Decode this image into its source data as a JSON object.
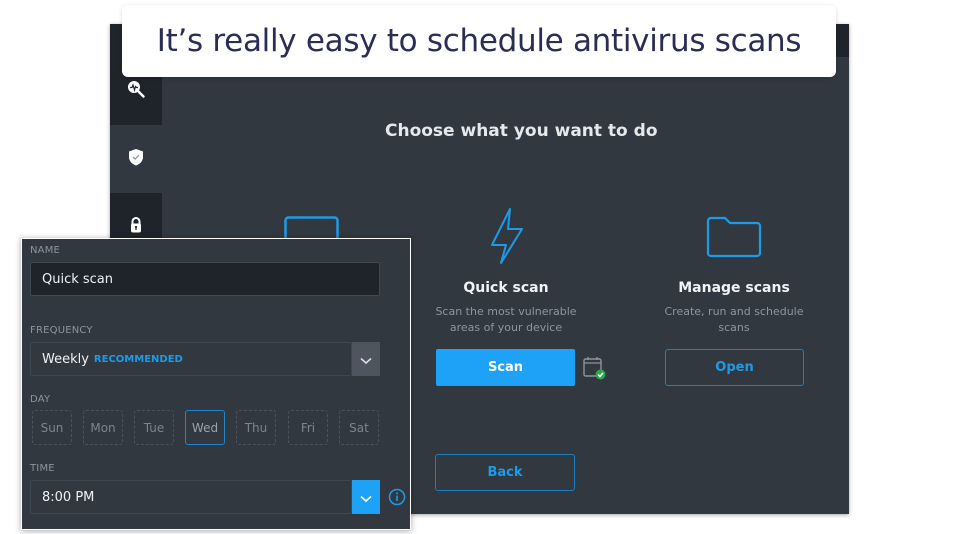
{
  "caption": "It’s really easy to schedule antivirus scans",
  "sidebar": {
    "items": [
      {
        "icon": "scan-search-icon",
        "active": false
      },
      {
        "icon": "shield-check-icon",
        "active": true
      },
      {
        "icon": "lock-icon",
        "active": false
      }
    ]
  },
  "main": {
    "title": "Choose what you want to do",
    "cards": [
      {
        "icon": "monitor-icon",
        "title": "",
        "description": ""
      },
      {
        "icon": "lightning-bolt-icon",
        "title": "Quick scan",
        "description": "Scan the most vulnerable areas of your device",
        "button": "Scan",
        "schedule_icon": "calendar-check-icon"
      },
      {
        "icon": "folder-icon",
        "title": "Manage scans",
        "description": "Create, run and schedule scans",
        "button": "Open"
      }
    ],
    "back_button": "Back"
  },
  "schedule_panel": {
    "name_label": "NAME",
    "name_value": "Quick scan",
    "frequency_label": "FREQUENCY",
    "frequency_value": "Weekly",
    "frequency_badge": "RECOMMENDED",
    "day_label": "DAY",
    "days": [
      "Sun",
      "Mon",
      "Tue",
      "Wed",
      "Thu",
      "Fri",
      "Sat"
    ],
    "selected_day": "Wed",
    "time_label": "TIME",
    "time_value": "8:00 PM"
  },
  "colors": {
    "accent": "#1ea2f7",
    "window_bg": "#323840",
    "sidebar_dark": "#1f242b",
    "caption_text": "#2b2d55",
    "success": "#2ea84a"
  }
}
